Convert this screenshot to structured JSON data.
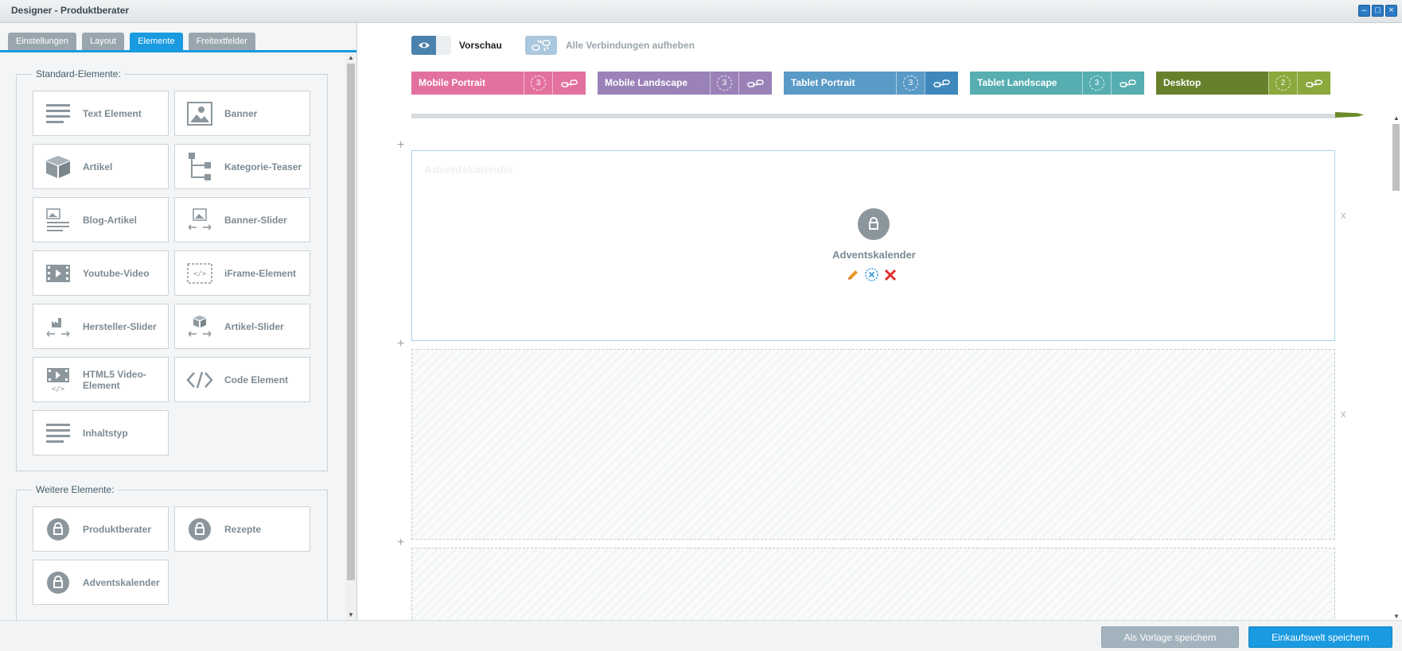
{
  "window": {
    "title": "Designer - Produktberater",
    "controls": [
      "minimize-icon",
      "maximize-icon",
      "close-icon"
    ]
  },
  "left_panel": {
    "tabs": [
      {
        "label": "Einstellungen",
        "active": false
      },
      {
        "label": "Layout",
        "active": false
      },
      {
        "label": "Elemente",
        "active": true
      },
      {
        "label": "Freitextfelder",
        "active": false
      }
    ],
    "standard_group": {
      "legend": "Standard-Elemente:",
      "items": [
        {
          "label": "Text Element",
          "icon": "text-lines-icon"
        },
        {
          "label": "Banner",
          "icon": "image-icon"
        },
        {
          "label": "Artikel",
          "icon": "box-icon"
        },
        {
          "label": "Kategorie-Teaser",
          "icon": "tree-icon"
        },
        {
          "label": "Blog-Artikel",
          "icon": "blog-article-icon"
        },
        {
          "label": "Banner-Slider",
          "icon": "banner-slider-icon"
        },
        {
          "label": "Youtube-Video",
          "icon": "video-film-icon"
        },
        {
          "label": "iFrame-Element",
          "icon": "iframe-icon"
        },
        {
          "label": "Hersteller-Slider",
          "icon": "factory-slider-icon"
        },
        {
          "label": "Artikel-Slider",
          "icon": "article-slider-icon"
        },
        {
          "label": "HTML5 Video-Element",
          "icon": "html5-video-icon"
        },
        {
          "label": "Code Element",
          "icon": "code-icon"
        },
        {
          "label": "Inhaltstyp",
          "icon": "content-type-icon"
        }
      ]
    },
    "more_group": {
      "legend": "Weitere Elemente:",
      "items": [
        {
          "label": "Produktberater",
          "icon": "plugin-icon"
        },
        {
          "label": "Rezepte",
          "icon": "plugin-icon"
        },
        {
          "label": "Adventskalender",
          "icon": "plugin-icon"
        }
      ]
    }
  },
  "toolbar": {
    "preview_label": "Vorschau",
    "unlink_label": "Alle Verbindungen aufheben"
  },
  "devices": [
    {
      "name": "Mobile Portrait",
      "count": "3",
      "color": "#e3719f",
      "linkcolor": "#e3719f"
    },
    {
      "name": "Mobile Landscape",
      "count": "3",
      "color": "#9a82b8",
      "linkcolor": "#9a82b8"
    },
    {
      "name": "Tablet Portrait",
      "count": "3",
      "color": "#5a9ac7",
      "linkcolor": "#3e88bd"
    },
    {
      "name": "Tablet Landscape",
      "count": "3",
      "color": "#56aeb1",
      "linkcolor": "#56aeb1"
    },
    {
      "name": "Desktop",
      "count": "2",
      "color": "#67802c",
      "linkcolor": "#8aa83c"
    }
  ],
  "canvas": {
    "row1": {
      "ghost_title": "Adventskalender",
      "element_title": "Adventskalender"
    },
    "close_marker": "x",
    "add_marker": "+"
  },
  "footer": {
    "save_template_label": "Als Vorlage speichern",
    "save_world_label": "Einkaufswelt speichern"
  }
}
